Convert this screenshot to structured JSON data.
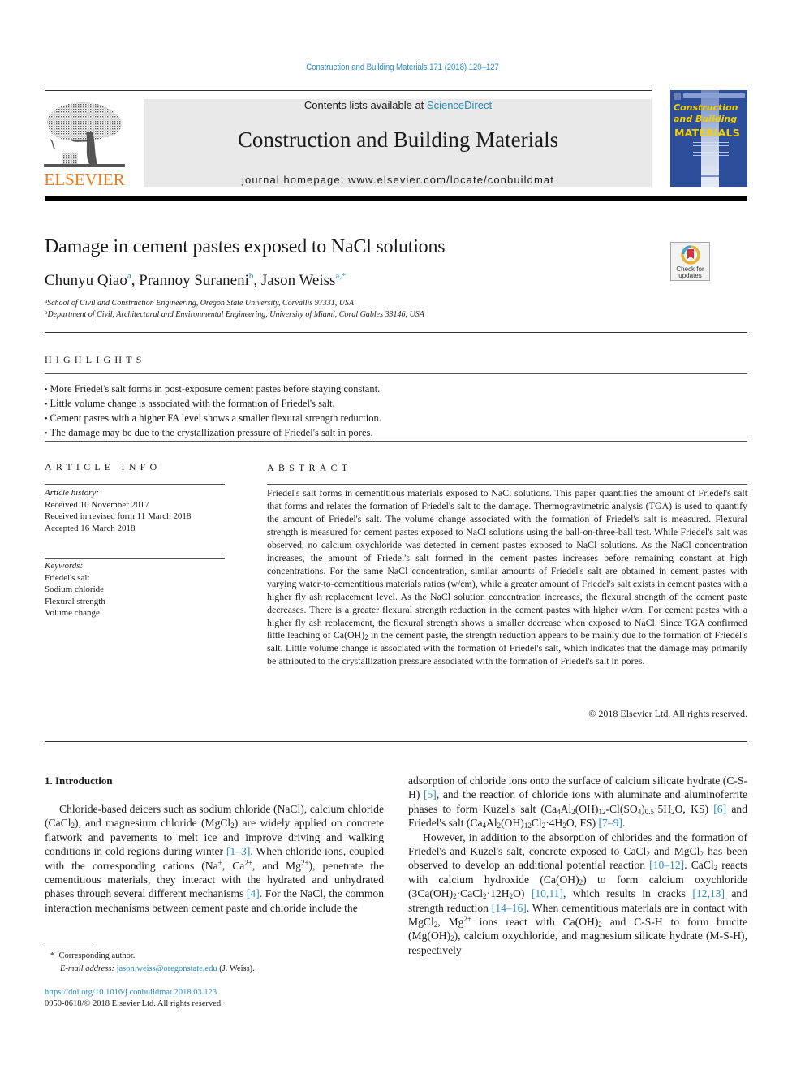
{
  "header": {
    "journal_reference": "Construction and Building Materials 171 (2018) 120–127",
    "contents_prefix": "Contents lists available at ",
    "contents_link": "ScienceDirect",
    "journal_name": "Construction and Building Materials",
    "homepage": "journal homepage: www.elsevier.com/locate/conbuildmat",
    "publisher_logo_text": "ELSEVIER",
    "cover": {
      "title_line1": "Construction",
      "title_line2": "and Building",
      "title_line3": "MATERIALS"
    }
  },
  "colors": {
    "link": "#2a8bbd",
    "elsevier_orange": "#f07d1a",
    "cover_blue": "#2d4f9b",
    "cover_yellow": "#f5d000",
    "banner_gray": "#e9e9e9"
  },
  "article": {
    "title": "Damage in cement pastes exposed to NaCl solutions",
    "authors": [
      {
        "name": "Chunyu Qiao",
        "sup": "a"
      },
      {
        "name": "Prannoy Suraneni",
        "sup": "b"
      },
      {
        "name": "Jason Weiss",
        "sup": "a,*"
      }
    ],
    "affiliations": [
      {
        "key": "a",
        "text": "School of Civil and Construction Engineering, Oregon State University, Corvallis 97331, USA"
      },
      {
        "key": "b",
        "text": "Department of Civil, Architectural and Environmental Engineering, University of Miami, Coral Gables 33146, USA"
      }
    ],
    "check_updates": {
      "line1": "Check for",
      "line2": "updates"
    }
  },
  "highlights": {
    "heading": "HIGHLIGHTS",
    "items": [
      "More Friedel's salt forms in post-exposure cement pastes before staying constant.",
      "Little volume change is associated with the formation of Friedel's salt.",
      "Cement pastes with a higher FA level shows a smaller flexural strength reduction.",
      "The damage may be due to the crystallization pressure of Friedel's salt in pores."
    ]
  },
  "article_info": {
    "heading": "ARTICLE INFO",
    "history_label": "Article history:",
    "history": [
      "Received 10 November 2017",
      "Received in revised form 11 March 2018",
      "Accepted 16 March 2018"
    ],
    "keywords_label": "Keywords:",
    "keywords": [
      "Friedel's salt",
      "Sodium chloride",
      "Flexural strength",
      "Volume change"
    ]
  },
  "abstract": {
    "heading": "ABSTRACT",
    "text_part1": "Friedel's salt forms in cementitious materials exposed to NaCl solutions. This paper quantifies the amount of Friedel's salt that forms and relates the formation of Friedel's salt to the damage. Thermogravimetric analysis (TGA) is used to quantify the amount of Friedel's salt. The volume change associated with the formation of Friedel's salt is measured. Flexural strength is measured for cement pastes exposed to NaCl solutions using the ball-on-three-ball test. While Friedel's salt was observed, no calcium oxychloride was detected in cement pastes exposed to NaCl solutions. As the NaCl concentration increases, the amount of Friedel's salt formed in the cement pastes increases before remaining constant at high concentrations. For the same NaCl concentration, similar amounts of Friedel's salt are obtained in cement pastes with varying water-to-cementitious materials ratios (w/cm), while a greater amount of Friedel's salt exists in cement pastes with a higher fly ash replacement level. As the NaCl solution concentration increases, the flexural strength of the cement paste decreases. There is a greater flexural strength reduction in the cement pastes with higher w/cm. For cement pastes with a higher fly ash replacement, the flexural strength shows a smaller decrease when exposed to NaCl. Since TGA confirmed little leaching of Ca(OH)",
    "text_sub": "2",
    "text_part2": " in the cement paste, the strength reduction appears to be mainly due to the formation of Friedel's salt. Little volume change is associated with the formation of Friedel's salt, which indicates that the damage may primarily be attributed to the crystallization pressure associated with the formation of Friedel's salt in pores.",
    "copyright": "© 2018 Elsevier Ltd. All rights reserved."
  },
  "introduction": {
    "heading": "1. Introduction",
    "refs": {
      "r1": "[1–3]",
      "r4": "[4]",
      "r5": "[5]",
      "r6": "[6]",
      "r7": "[7–9]",
      "r10": "[10–12]",
      "r1011": "[10,11]",
      "r1213": "[12,13]",
      "r1416": "[14–16]"
    }
  },
  "footnotes": {
    "corresponding_mark": "*",
    "corresponding": "Corresponding author.",
    "email_label": "E-mail address:",
    "email": "jason.weiss@oregonstate.edu",
    "email_suffix": " (J. Weiss).",
    "doi": "https://doi.org/10.1016/j.conbuildmat.2018.03.123",
    "issn_line": "0950-0618/© 2018 Elsevier Ltd. All rights reserved."
  }
}
